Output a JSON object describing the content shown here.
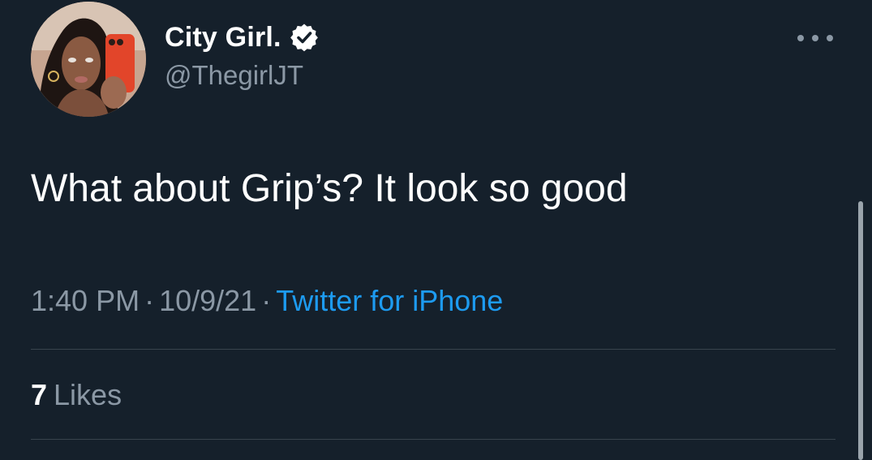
{
  "author": {
    "display_name": "City Girl.",
    "handle": "@ThegirlJT",
    "verified": true,
    "avatar_icon": "profile-photo"
  },
  "tweet": {
    "text": "What about Grip’s? It look so good",
    "time": "1:40 PM",
    "date": "10/9/21",
    "separator": "·",
    "source": "Twitter for iPhone"
  },
  "stats": {
    "likes_count": "7",
    "likes_label": "Likes"
  },
  "icons": {
    "more": "more-options-icon",
    "verified": "verified-badge-icon"
  },
  "colors": {
    "background": "#15202b",
    "text_primary": "#ffffff",
    "text_secondary": "#8b98a5",
    "link": "#1d9bf0",
    "divider": "#38444d"
  }
}
